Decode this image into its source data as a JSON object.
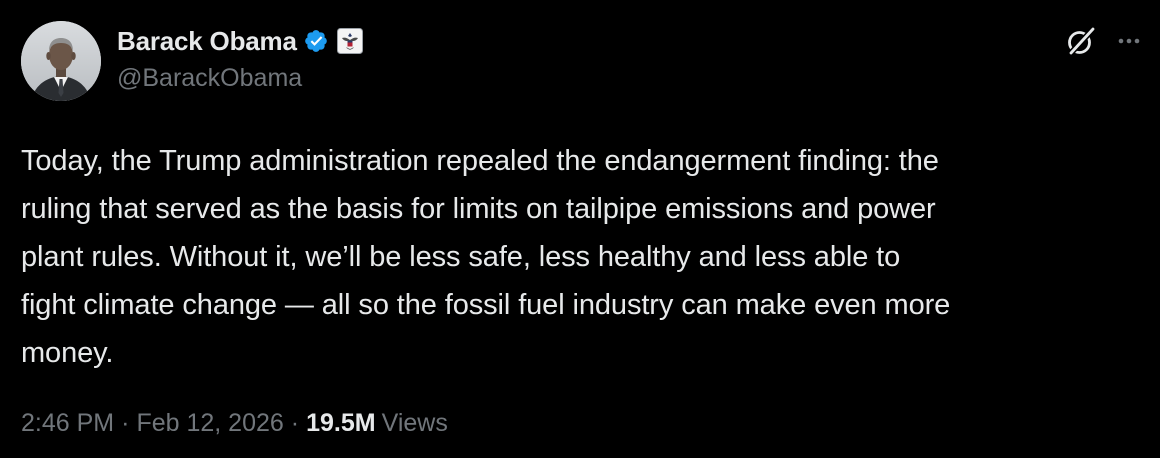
{
  "author": {
    "display_name": "Barack Obama",
    "handle": "@BarackObama",
    "verified": true,
    "verified_color": "#1d9bf0",
    "affiliation_badge": "us-government-seal-icon"
  },
  "tweet": {
    "text": "Today, the Trump administration repealed the endangerment finding: the\nruling that served as the basis for limits on tailpipe emissions and power\nplant rules. Without it, we’ll be less safe, less healthy and less able to\nfight climate change — all so the fossil fuel industry can make even more\nmoney."
  },
  "meta": {
    "time": "2:46 PM",
    "separator": "·",
    "date": "Feb 12, 2026",
    "views_count": "19.5M",
    "views_label": "Views"
  },
  "actions": {
    "grok_icon": "grok-icon",
    "more_icon": "more-horizontal-icon"
  },
  "colors": {
    "background": "#000000",
    "primary_text": "#e7e9ea",
    "secondary_text": "#71767b"
  }
}
